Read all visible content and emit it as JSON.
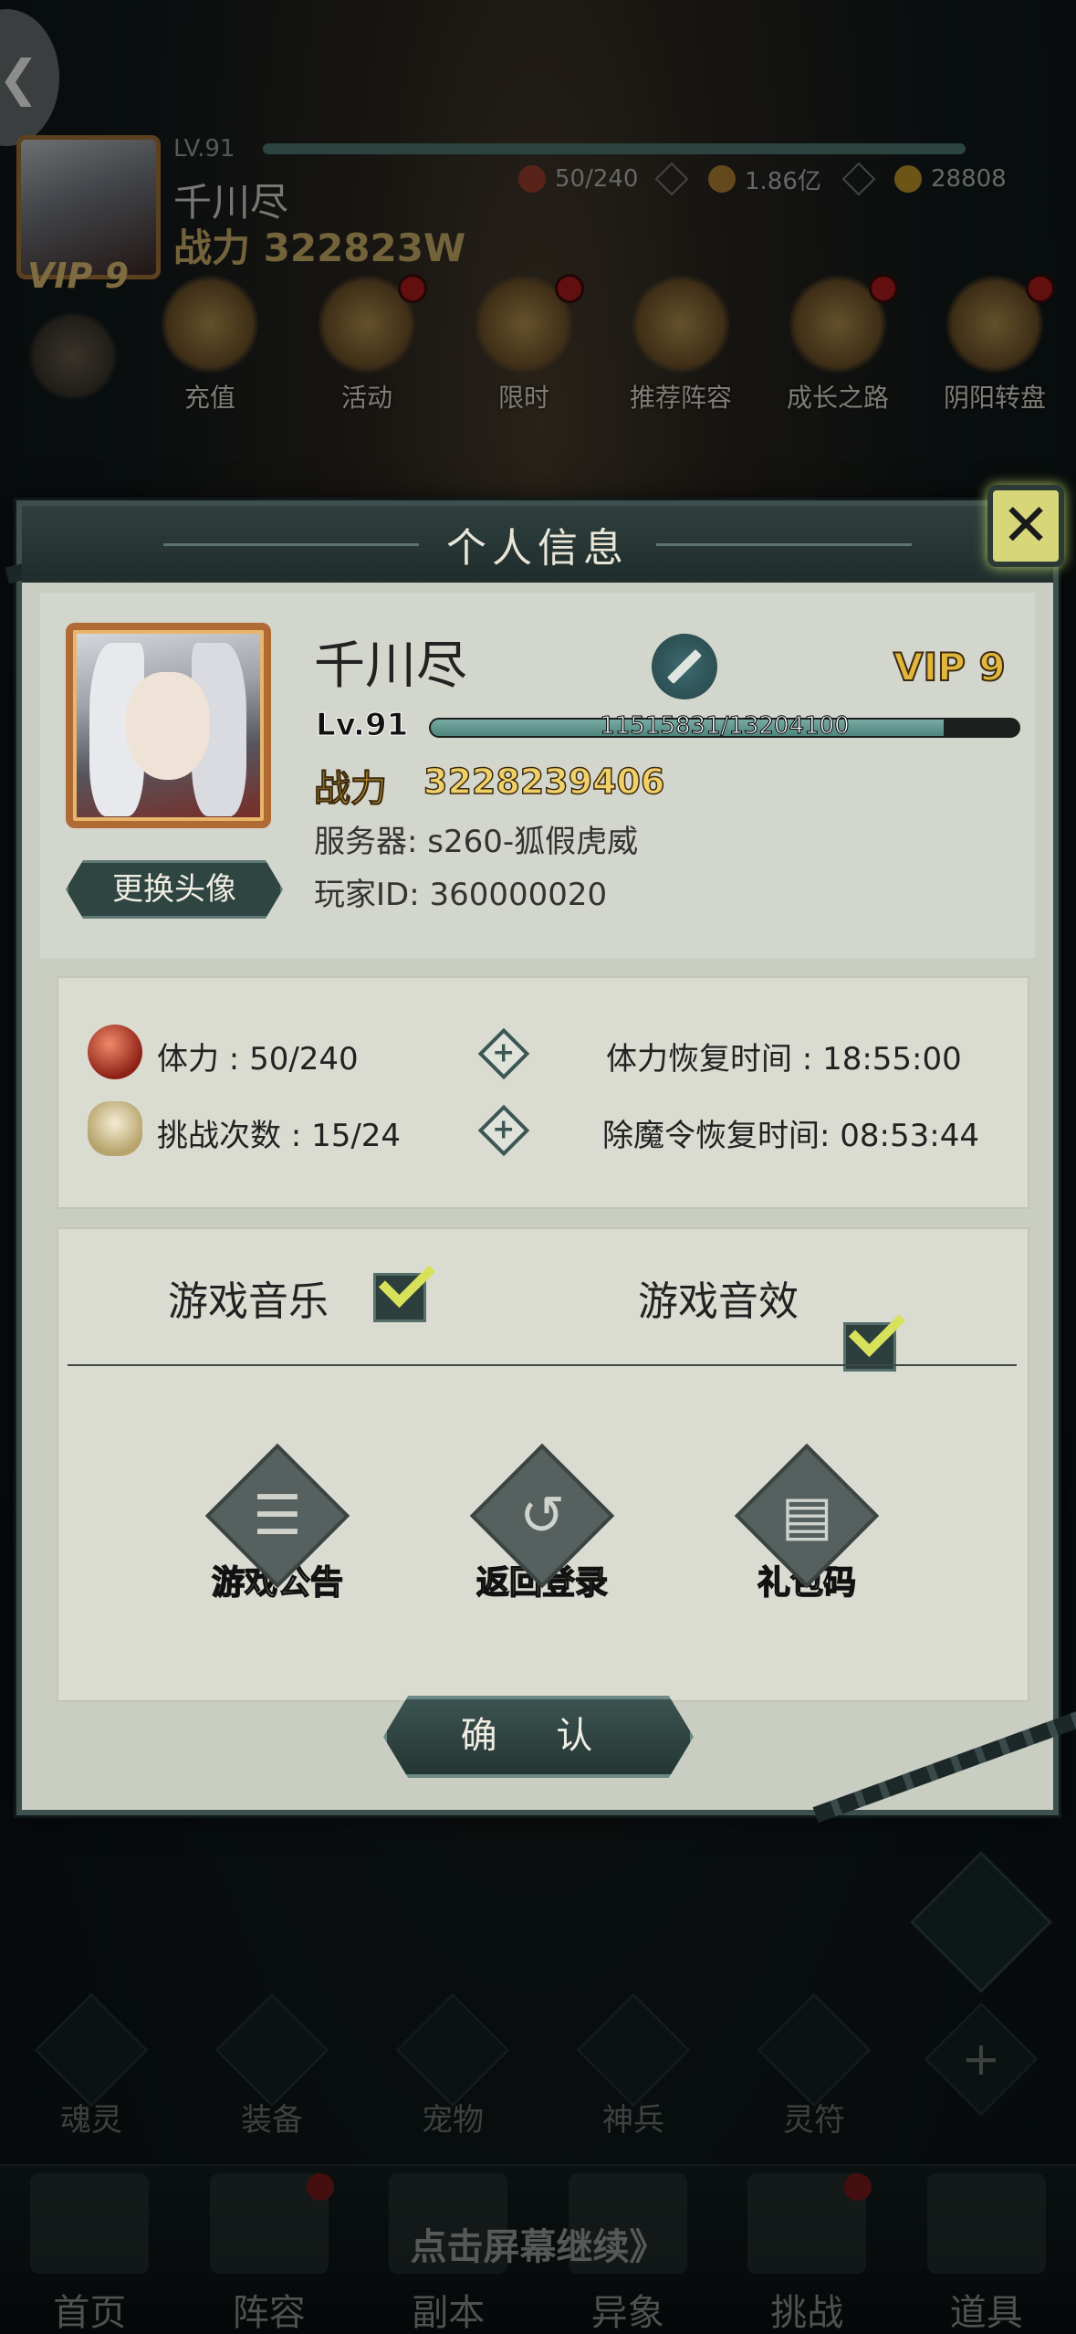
{
  "hud": {
    "level": "LV.91",
    "player_name": "千川尽",
    "power": "战力 322823W",
    "vip": "VIP 9",
    "stamina": "50/240",
    "coins": "1.86亿",
    "gems": "28808",
    "menu": [
      "充值",
      "活动",
      "限时",
      "推荐阵容",
      "成长之路",
      "阴阳转盘"
    ]
  },
  "modal": {
    "title": "个人信息",
    "close_icon": "x-icon",
    "profile": {
      "name": "千川尽",
      "vip": "VIP 9",
      "level": "Lv.91",
      "exp_text": "11515831/13204100",
      "exp_fraction": 0.872,
      "power_label": "战力",
      "power_value": "3228239406",
      "server": "服务器: s260-狐假虎威",
      "player_id": "玩家ID: 360000020",
      "change_avatar": "更换头像"
    },
    "stats": {
      "stamina_label": "体力 : 50/240",
      "stamina_recover": "体力恢复时间 : 18:55:00",
      "challenge_label": "挑战次数 : 15/24",
      "token_recover": "除魔令恢复时间: 08:53:44"
    },
    "settings": {
      "music": "游戏音乐",
      "music_on": true,
      "sfx": "游戏音效",
      "sfx_on": true
    },
    "actions": {
      "announcement": "游戏公告",
      "return_login": "返回登录",
      "gift_code": "礼包码"
    },
    "confirm": "确 认"
  },
  "bottom": {
    "sub_nav": [
      "魂灵",
      "装备",
      "宠物",
      "神兵",
      "灵符"
    ],
    "continue_text": "点击屏幕继续》",
    "nav": [
      "首页",
      "阵容",
      "副本",
      "异象",
      "挑战",
      "道具"
    ]
  },
  "colors": {
    "panel": "#c9cdc2",
    "frame": "#3d504d",
    "gold": "#e1b63b",
    "exp_fill": "#4d857c"
  }
}
